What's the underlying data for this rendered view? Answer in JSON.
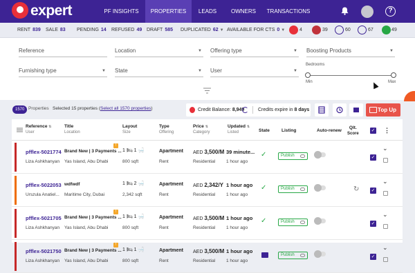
{
  "app": {
    "brand": "expert"
  },
  "nav": {
    "items": [
      {
        "label": "PF INSIGHTS"
      },
      {
        "label": "PROPERTIES"
      },
      {
        "label": "LEADS"
      },
      {
        "label": "OWNERS"
      },
      {
        "label": "TRANSACTIONS"
      }
    ],
    "active": "PROPERTIES",
    "help": "?"
  },
  "stats": {
    "rent_label": "RENT",
    "rent": "839",
    "sale_label": "SALE",
    "sale": "83",
    "pending_label": "PENDING",
    "pending": "14",
    "refused_label": "REFUSED",
    "refused": "49",
    "draft_label": "DRAFT",
    "draft": "585",
    "duplicated_label": "DUPLICATED",
    "duplicated": "62",
    "available_label": "AVAILABLE FOR CTS",
    "available": "0",
    "icon_counts": [
      "4",
      "39",
      "60",
      "67",
      "49"
    ],
    "icon_colors": [
      "#e8303a",
      "#c0323b",
      "#3d2394",
      "#3d2394",
      "#27a745"
    ]
  },
  "filters": {
    "reference": "Reference",
    "location": "Location",
    "offering_type": "Offering type",
    "boosting": "Boosting Products",
    "furnishing": "Furnishing type",
    "state": "State",
    "user": "User",
    "bedrooms_label": "Bedrooms",
    "min": "Min",
    "max": "Max"
  },
  "toolbar": {
    "count": "1570",
    "properties_label": "Properties",
    "selected_text": "Selected 15 properties (",
    "select_all": "Select all 1570 properties",
    "select_close": ")",
    "credit_label": "Credit Balance:",
    "credit_value": "8,949",
    "expire_label": "Credits expire in",
    "expire_value": "8 days",
    "topup_label": "Top Up"
  },
  "table": {
    "headers": {
      "reference": "Reference",
      "reference_sub": "User",
      "title": "Title",
      "title_sub": "Location",
      "layout": "Layout",
      "layout_sub": "Size",
      "type": "Type",
      "type_sub": "Offering",
      "price": "Price",
      "price_sub": "Category",
      "updated": "Updated",
      "updated_sub": "Listed",
      "state": "State",
      "listing": "Listing",
      "autorenew": "Auto-renew",
      "quality": "Qlt.",
      "quality2": "Score"
    },
    "rows": [
      {
        "ref": "pfflex-5021774",
        "user": "Liza Ashkhanyan",
        "title": "Brand New | 3 Payments ...",
        "location": "Yas Island, Abu Dhabi",
        "layout": "1 🛏 1 🛁",
        "size": "800 sqft",
        "type": "Apartment",
        "offering": "Rent",
        "price_cur": "AED",
        "price": "3,500/M",
        "category": "Residential",
        "updated": "39 minute...",
        "listed": "1 hour ago",
        "listing": "Publish",
        "bar": "#c62828",
        "state": "check",
        "warn": true
      },
      {
        "ref": "pfflex-5022053",
        "user": "Urszula Anatiel...",
        "title": "wdfwdf",
        "location": "Maritime City, Dubai",
        "layout": "1 🛏 2 🛁",
        "size": "2,342 sqft",
        "type": "Apartment",
        "offering": "Rent",
        "price_cur": "AED",
        "price": "2,342/Y",
        "category": "Residential",
        "updated": "1 hour ago",
        "listed": "1 hour ago",
        "listing": "Publish",
        "bar": "#ef6c00",
        "state": "check",
        "warn": false
      },
      {
        "ref": "pfflex-5021705",
        "user": "Liza Ashkhanyan",
        "title": "Brand New | 3 Payments ...",
        "location": "Yas Island, Abu Dhabi",
        "layout": "1 🛏 1 🛁",
        "size": "800 sqft",
        "type": "Apartment",
        "offering": "Rent",
        "price_cur": "AED",
        "price": "3,500/M",
        "category": "Residential",
        "updated": "1 hour ago",
        "listed": "1 hour ago",
        "listing": "Publish",
        "bar": "#c62828",
        "state": "check",
        "warn": true
      },
      {
        "ref": "pfflex-5021750",
        "user": "Liza Ashkhanyan",
        "title": "Brand New | 3 Payments ...",
        "location": "Yas Island, Abu Dhabi",
        "layout": "1 🛏 1 🛁",
        "size": "800 sqft",
        "type": "Apartment",
        "offering": "Rent",
        "price_cur": "AED",
        "price": "3,500/M",
        "category": "Residential",
        "updated": "1 hour ago",
        "listed": "1 hour ago",
        "listing": "Publish",
        "bar": "#c62828",
        "state": "mail",
        "warn": true
      }
    ]
  }
}
